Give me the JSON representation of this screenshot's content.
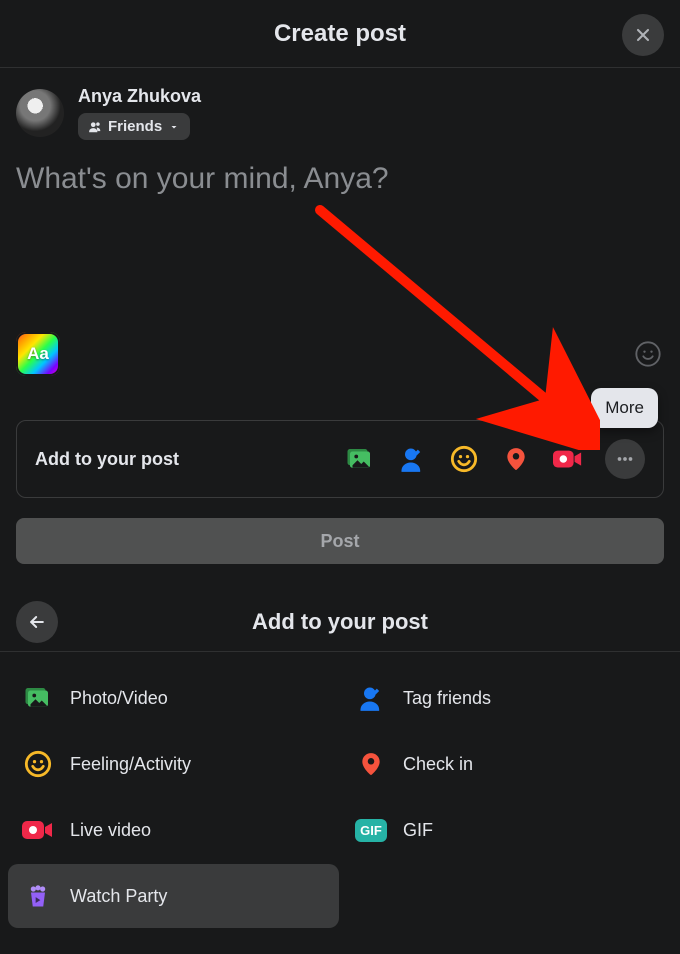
{
  "header": {
    "title": "Create post"
  },
  "user": {
    "name": "Anya Zhukova",
    "audience_label": "Friends"
  },
  "compose": {
    "placeholder": "What's on your mind, Anya?",
    "bg_label": "Aa"
  },
  "add_bar": {
    "label": "Add to your post"
  },
  "tooltip": {
    "more": "More"
  },
  "post_button": {
    "label": "Post"
  },
  "section": {
    "title": "Add to your post"
  },
  "options": {
    "photo_video": "Photo/Video",
    "tag_friends": "Tag friends",
    "feeling": "Feeling/Activity",
    "check_in": "Check in",
    "live_video": "Live video",
    "gif": "GIF",
    "gif_badge": "GIF",
    "watch_party": "Watch Party"
  },
  "colors": {
    "photo": "#45bd62",
    "tag": "#1877f2",
    "feeling": "#f7b928",
    "checkin": "#f5533d",
    "live": "#f02849",
    "gif": "#26b3a6",
    "watch": "#9360f7",
    "more": "#a5a7ab"
  }
}
